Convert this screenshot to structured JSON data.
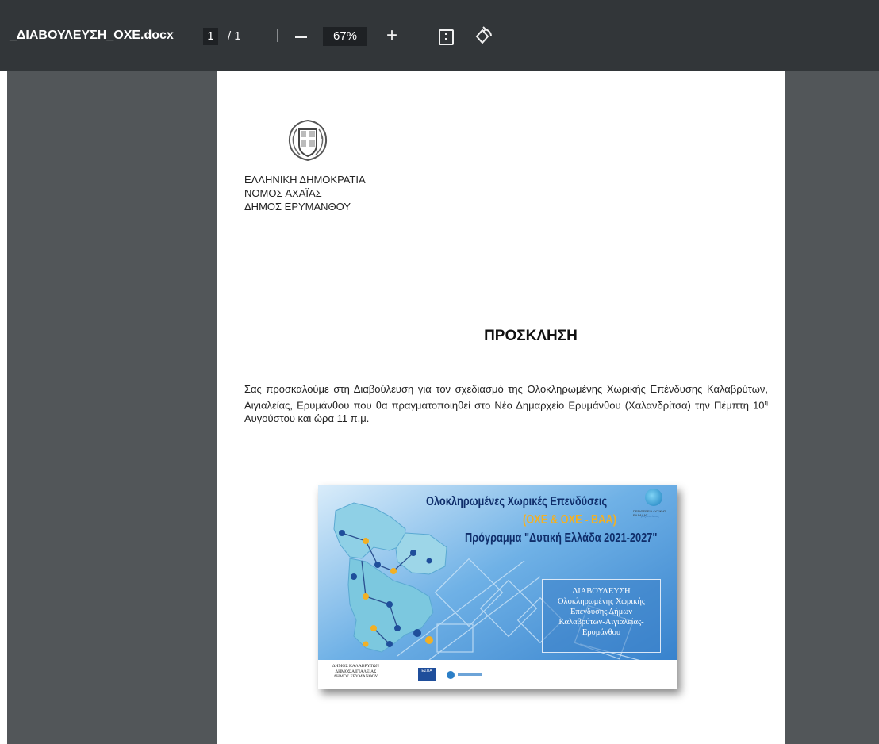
{
  "toolbar": {
    "filename": "_ΔΙΑΒΟΥΛΕΥΣΗ_ΟΧΕ.docx",
    "current_page": "1",
    "page_separator": "/",
    "total_pages": "1",
    "zoom": "67%"
  },
  "document": {
    "org_lines": [
      "ΕΛΛΗΝΙΚΗ ΔΗΜΟΚΡΑΤΙΑ",
      "ΝΟΜΟΣ ΑΧΑΪΑΣ",
      "ΔΗΜΟΣ ΕΡΥΜΑΝΘΟΥ"
    ],
    "title": "ΠΡΟΣΚΛΗΣΗ",
    "body_before_sup": "Σας προσκαλούμε στη Διαβούλευση για τον σχεδιασμό της Ολοκληρωμένης Χωρικής Επένδυσης Καλαβρύτων, Αιγιαλείας, Ερυμάνθου που θα πραγματοποιηθεί στο Νέο Δημαρχείο Ερυμάνθου (Χαλανδρίτσα) την Πέμπτη 10",
    "body_sup": "η",
    "body_after_sup": " Αυγούστου και ώρα 11 π.μ.",
    "banner": {
      "title_line1": "Ολοκληρωμένες Χωρικές Επενδύσεις",
      "title_line2": "(ΟΧΕ & ΟΧΕ - ΒΑΑ)",
      "title_line3": "Πρόγραμμα \"Δυτική Ελλάδα 2021-2027\"",
      "box_lines": [
        "ΔΙΑΒΟΥΛΕΥΣΗ",
        "Ολοκληρωμένης Χωρικής",
        "Επένδυσης Δήμων",
        "Καλαβρύτων-Αιγιαλείας-",
        "Ερυμάνθου"
      ],
      "footer_lines": [
        "ΔΗΜΟΣ ΚΑΛΑΒΡΥΤΩΝ",
        "ΔΗΜΟΣ ΑΙΓΙΑΛΕΙΑΣ",
        "ΔΗΜΟΣ ΕΡΥΜΑΝΘΟΥ"
      ],
      "espa_label": "ΕΣΠΑ",
      "region_logo_text": "ΠΕΡΙΦΕΡΕΙΑ ΔΥΤΙΚΗΣ ΕΛΛΑΔΑΣ",
      "region_logo_sub": "μαζί εκείνους"
    }
  },
  "colors": {
    "toolbar_bg": "#323639",
    "viewer_bg": "#525659",
    "banner_title": "#0f2d6a",
    "banner_accent": "#f2b024"
  },
  "icons": [
    "zoom-out-icon",
    "zoom-in-icon",
    "fit-page-icon",
    "rotate-icon",
    "greek-emblem-icon"
  ]
}
